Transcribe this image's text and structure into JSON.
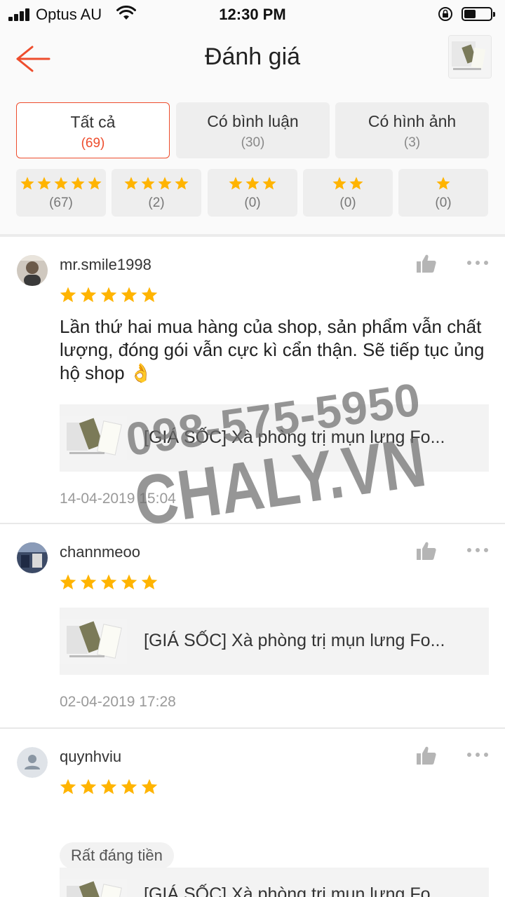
{
  "status_bar": {
    "carrier": "Optus AU",
    "time": "12:30 PM"
  },
  "header": {
    "title": "Đánh giá"
  },
  "filters": {
    "tabs": [
      {
        "label": "Tất cả",
        "count": "(69)",
        "active": true
      },
      {
        "label": "Có bình luận",
        "count": "(30)",
        "active": false
      },
      {
        "label": "Có hình ảnh",
        "count": "(3)",
        "active": false
      }
    ],
    "star_filters": [
      {
        "stars": 5,
        "count": "(67)"
      },
      {
        "stars": 4,
        "count": "(2)"
      },
      {
        "stars": 3,
        "count": "(0)"
      },
      {
        "stars": 2,
        "count": "(0)"
      },
      {
        "stars": 1,
        "count": "(0)"
      }
    ]
  },
  "reviews": [
    {
      "username": "mr.smile1998",
      "rating": 5,
      "comment": "Lần thứ hai mua hàng của shop, sản phẩm vẫn chất lượng, đóng gói vẫn cực kì cẩn thận. Sẽ tiếp tục ủng hộ shop 👌",
      "product_name": "[GIÁ SỐC] Xà phòng trị mụn lưng Fo...",
      "date": "14-04-2019 15:04"
    },
    {
      "username": "channmeoo",
      "rating": 5,
      "product_name": "[GIÁ SỐC] Xà phòng trị mụn lưng Fo...",
      "date": "02-04-2019 17:28"
    },
    {
      "username": "quynhviu",
      "rating": 5,
      "tag": "Rất đáng tiền",
      "product_name": "[GIÁ SỐC] Xà phòng trị mụn lưng Fo..."
    }
  ],
  "watermark": {
    "phone": "098-575-5950",
    "site": "CHALY.VN"
  },
  "colors": {
    "accent": "#ee4d2d",
    "star": "#ffb400"
  }
}
